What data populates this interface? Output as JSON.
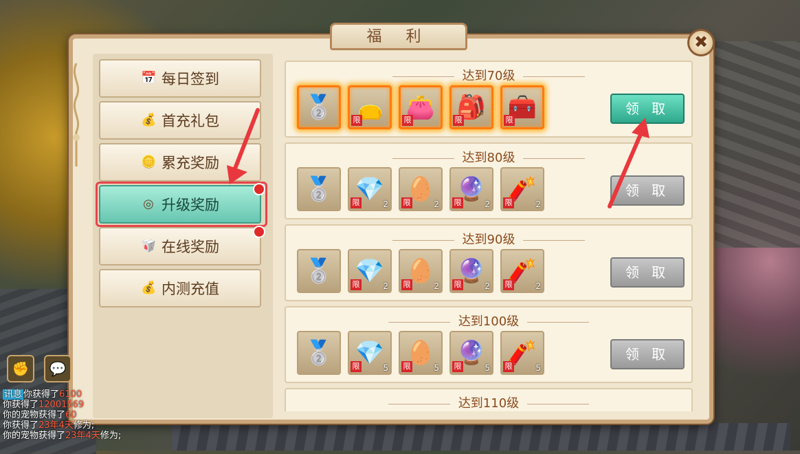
{
  "window": {
    "title": "福 利",
    "close": "✖"
  },
  "sidebar": {
    "items": [
      {
        "label": "每日签到",
        "icon": "calendar-icon",
        "glyph": "📅"
      },
      {
        "label": "首充礼包",
        "icon": "money-bag-icon",
        "glyph": "💰"
      },
      {
        "label": "累充奖励",
        "icon": "coins-icon",
        "glyph": "🪙"
      },
      {
        "label": "升级奖励",
        "icon": "level-up-icon",
        "glyph": "◎"
      },
      {
        "label": "在线奖励",
        "icon": "ingot-icon",
        "glyph": "🥡"
      },
      {
        "label": "内测充值",
        "icon": "pouch-icon",
        "glyph": "💰"
      }
    ],
    "active_index": 3
  },
  "rewards": [
    {
      "level": "达到70级",
      "claim": "领 取",
      "claimable": true,
      "items": [
        {
          "icon": "silver-ingot-icon",
          "glyph": "🥈",
          "limited": false,
          "count": ""
        },
        {
          "icon": "gold-bag-icon",
          "glyph": "👝",
          "limited": true,
          "count": ""
        },
        {
          "icon": "purple-bag-icon",
          "glyph": "👛",
          "limited": true,
          "count": ""
        },
        {
          "icon": "green-bag-icon",
          "glyph": "🎒",
          "limited": true,
          "count": ""
        },
        {
          "icon": "treasure-chest-icon",
          "glyph": "🧰",
          "limited": true,
          "count": ""
        }
      ]
    },
    {
      "level": "达到80级",
      "claim": "领 取",
      "claimable": false,
      "items": [
        {
          "icon": "silver-ingot-icon",
          "glyph": "🥈",
          "limited": false,
          "count": ""
        },
        {
          "icon": "blue-gem-icon",
          "glyph": "💎",
          "limited": true,
          "count": "2"
        },
        {
          "icon": "golden-egg-icon",
          "glyph": "🥚",
          "limited": true,
          "count": "2"
        },
        {
          "icon": "purple-orb-icon",
          "glyph": "🔮",
          "limited": true,
          "count": "2"
        },
        {
          "icon": "firecracker-icon",
          "glyph": "🧨",
          "limited": true,
          "count": "2"
        }
      ]
    },
    {
      "level": "达到90级",
      "claim": "领 取",
      "claimable": false,
      "items": [
        {
          "icon": "silver-ingot-icon",
          "glyph": "🥈",
          "limited": false,
          "count": ""
        },
        {
          "icon": "blue-gem-icon",
          "glyph": "💎",
          "limited": true,
          "count": "2"
        },
        {
          "icon": "golden-egg-icon",
          "glyph": "🥚",
          "limited": true,
          "count": "2"
        },
        {
          "icon": "purple-orb-icon",
          "glyph": "🔮",
          "limited": true,
          "count": "2"
        },
        {
          "icon": "firecracker-icon",
          "glyph": "🧨",
          "limited": true,
          "count": "2"
        }
      ]
    },
    {
      "level": "达到100级",
      "claim": "领 取",
      "claimable": false,
      "items": [
        {
          "icon": "silver-ingot-icon",
          "glyph": "🥈",
          "limited": false,
          "count": ""
        },
        {
          "icon": "blue-gem-icon",
          "glyph": "💎",
          "limited": true,
          "count": "5"
        },
        {
          "icon": "golden-egg-icon",
          "glyph": "🥚",
          "limited": true,
          "count": "5"
        },
        {
          "icon": "purple-orb-icon",
          "glyph": "🔮",
          "limited": true,
          "count": "5"
        },
        {
          "icon": "firecracker-icon",
          "glyph": "🧨",
          "limited": true,
          "count": "5"
        }
      ]
    },
    {
      "level": "达到110级",
      "claim": "",
      "claimable": false,
      "items": []
    }
  ],
  "limited_label": "限",
  "chat": {
    "tag": "讯息",
    "lines": [
      {
        "prefix": "你获得了",
        "value": "6100"
      },
      {
        "prefix": "你获得了",
        "value": "12001569"
      },
      {
        "prefix": "你的宠物获得了",
        "value": "60"
      },
      {
        "prefix": "你获得了",
        "value": "23年4天",
        "suffix": "修为;"
      },
      {
        "prefix": "你的宠物获得了",
        "value": "23年4天",
        "suffix": "修为;"
      }
    ]
  }
}
